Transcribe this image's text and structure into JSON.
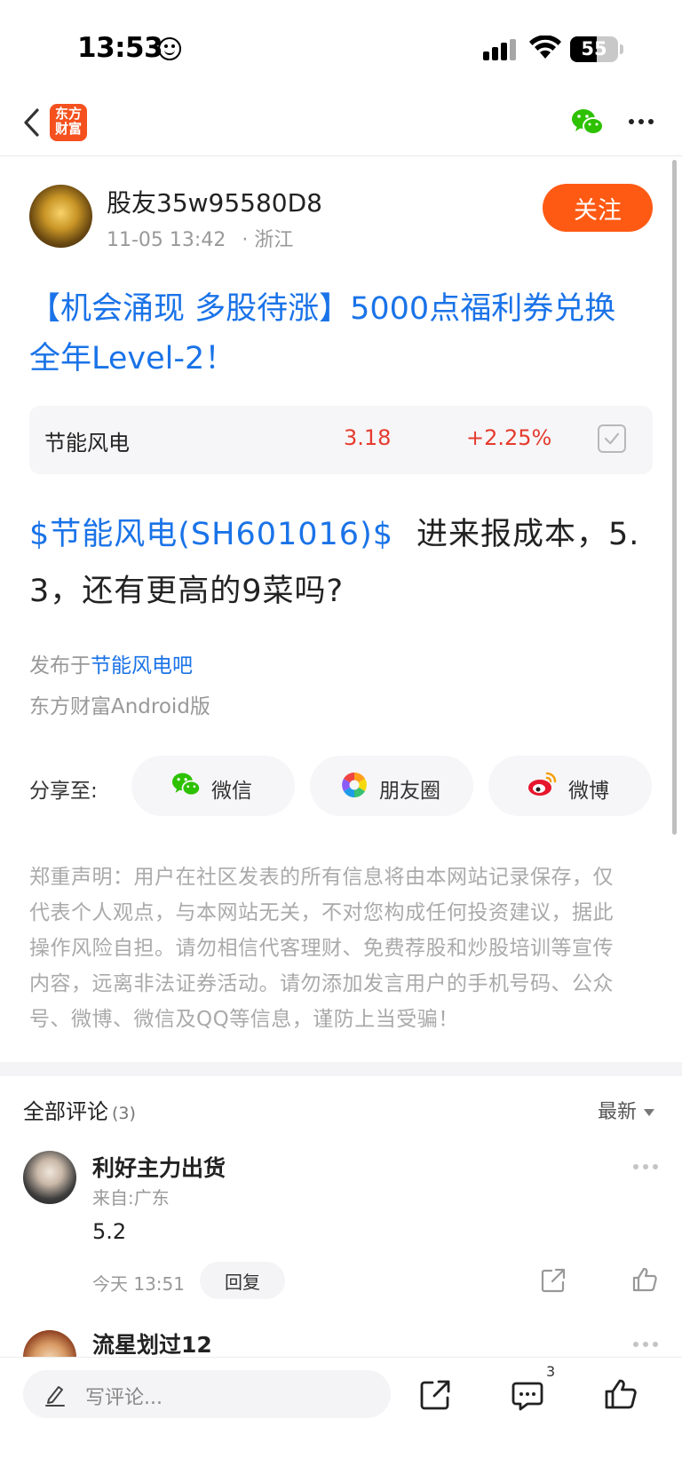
{
  "status_bar": {
    "time": "13:53",
    "battery_level": 55,
    "battery_text": "55"
  },
  "nav": {
    "app_logo_line1": "东方",
    "app_logo_line2": "财富",
    "brand_color": "#f4511e"
  },
  "post": {
    "author_name": "股友35w95580D8",
    "timestamp": "11-05 13:42",
    "location": "· 浙江",
    "follow_label": "关注",
    "title_line1": "【机会涌现 多股待涨】5000点福利券兑换",
    "title_line2": "全年Level-2！",
    "stock": {
      "name": "节能风电",
      "price": "3.18",
      "change": "+2.25%"
    },
    "body_link": "$节能风电(SH601016)$",
    "body_text_line1": "进来报成本，5.",
    "body_text_line2": "3，还有更高的9菜吗?",
    "posted_in_prefix": "发布于",
    "posted_in_bar": "节能风电吧",
    "client": "东方财富Android版"
  },
  "share": {
    "label": "分享至:",
    "wechat": "微信",
    "moments": "朋友圈",
    "weibo": "微博"
  },
  "disclaimer": {
    "line1": "郑重声明：用户在社区发表的所有信息将由本网站记录保存，仅",
    "line2": "代表个人观点，与本网站无关，不对您构成任何投资建议，据此",
    "line3": "操作风险自担。请勿相信代客理财、免费荐股和炒股培训等宣传",
    "line4": "内容，远离非法证券活动。请勿添加发言用户的手机号码、公众",
    "line5": "号、微博、微信及QQ等信息，谨防上当受骗！"
  },
  "comments": {
    "title": "全部评论",
    "count": "(3)",
    "sort": "最新",
    "items": [
      {
        "name": "利好主力出货",
        "from": "来自:广东",
        "text": "5.2",
        "time": "今天 13:51",
        "reply_label": "回复"
      },
      {
        "name": "流星划过12"
      }
    ]
  },
  "bottom_bar": {
    "placeholder": "写评论...",
    "comment_count": "3"
  },
  "colors": {
    "link_blue": "#1a73e8",
    "follow_orange": "#ff5a14",
    "stock_up_red": "#e63b2e",
    "wechat_green": "#2dc100"
  }
}
